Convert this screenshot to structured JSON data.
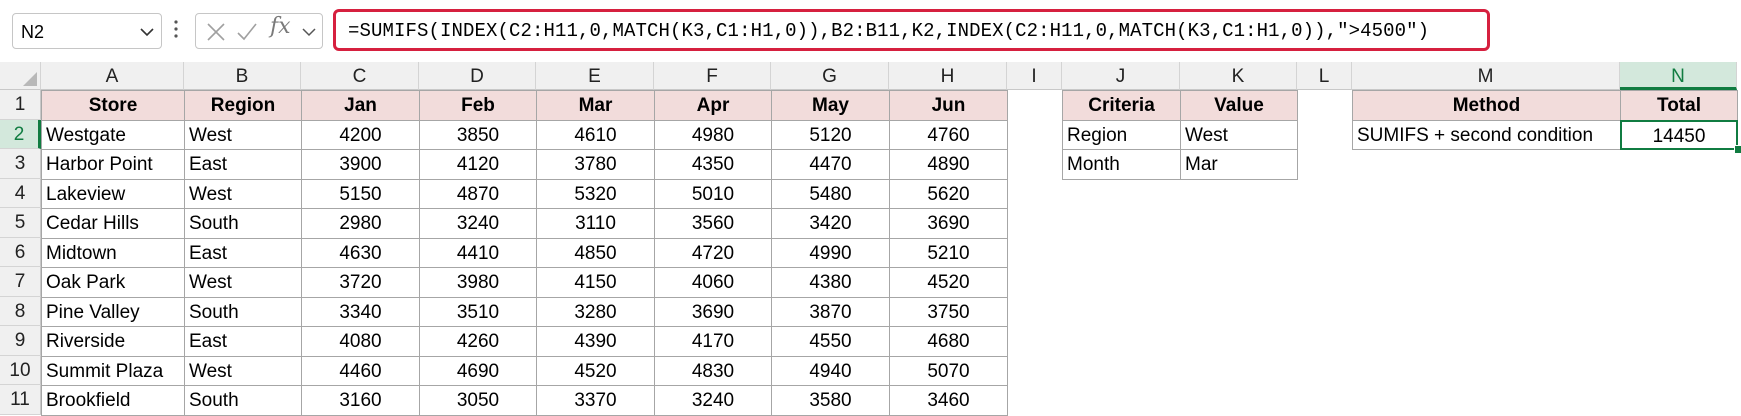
{
  "name_box": {
    "value": "N2"
  },
  "formula_bar": {
    "fx_label": "fx",
    "formula": "=SUMIFS(INDEX(C2:H11,0,MATCH(K3,C1:H1,0)),B2:B11,K2,INDEX(C2:H11,0,MATCH(K3,C1:H1,0)),\">4500\")"
  },
  "columns": [
    "A",
    "B",
    "C",
    "D",
    "E",
    "F",
    "G",
    "H",
    "I",
    "J",
    "K",
    "L",
    "M",
    "N"
  ],
  "rows": [
    "1",
    "2",
    "3",
    "4",
    "5",
    "6",
    "7",
    "8",
    "9",
    "10",
    "11"
  ],
  "sales_table": {
    "headers": [
      "Store",
      "Region",
      "Jan",
      "Feb",
      "Mar",
      "Apr",
      "May",
      "Jun"
    ],
    "rows": [
      [
        "Westgate",
        "West",
        "4200",
        "3850",
        "4610",
        "4980",
        "5120",
        "4760"
      ],
      [
        "Harbor Point",
        "East",
        "3900",
        "4120",
        "3780",
        "4350",
        "4470",
        "4890"
      ],
      [
        "Lakeview",
        "West",
        "5150",
        "4870",
        "5320",
        "5010",
        "5480",
        "5620"
      ],
      [
        "Cedar Hills",
        "South",
        "2980",
        "3240",
        "3110",
        "3560",
        "3420",
        "3690"
      ],
      [
        "Midtown",
        "East",
        "4630",
        "4410",
        "4850",
        "4720",
        "4990",
        "5210"
      ],
      [
        "Oak Park",
        "West",
        "3720",
        "3980",
        "4150",
        "4060",
        "4380",
        "4520"
      ],
      [
        "Pine Valley",
        "South",
        "3340",
        "3510",
        "3280",
        "3690",
        "3870",
        "3750"
      ],
      [
        "Riverside",
        "East",
        "4080",
        "4260",
        "4390",
        "4170",
        "4550",
        "4680"
      ],
      [
        "Summit Plaza",
        "West",
        "4460",
        "4690",
        "4520",
        "4830",
        "4940",
        "5070"
      ],
      [
        "Brookfield",
        "South",
        "3160",
        "3050",
        "3370",
        "3240",
        "3580",
        "3460"
      ]
    ]
  },
  "criteria_table": {
    "headers": [
      "Criteria",
      "Value"
    ],
    "rows": [
      [
        "Region",
        "West"
      ],
      [
        "Month",
        "Mar"
      ]
    ]
  },
  "result_table": {
    "headers": [
      "Method",
      "Total"
    ],
    "rows": [
      [
        "SUMIFS + second condition",
        "14450"
      ]
    ]
  },
  "colors": {
    "accent_green": "#107c41",
    "header_fill": "#f2dcdb",
    "formula_highlight": "#d6203f"
  }
}
